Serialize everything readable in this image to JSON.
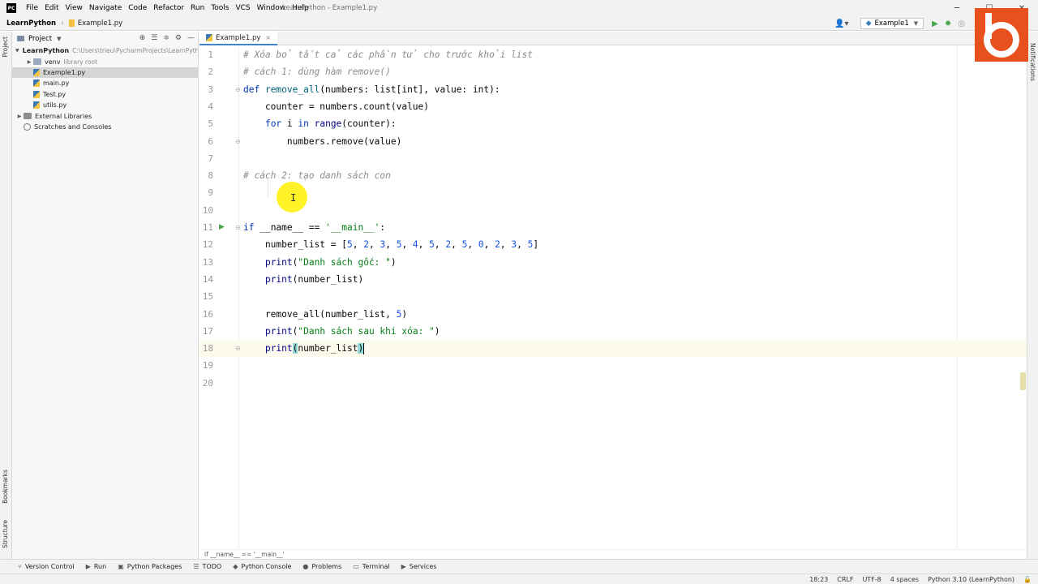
{
  "app": {
    "logo_text": "PC",
    "window_title": "LearnPython - Example1.py",
    "menu": [
      "File",
      "Edit",
      "View",
      "Navigate",
      "Code",
      "Refactor",
      "Run",
      "Tools",
      "VCS",
      "Window",
      "Help"
    ],
    "window_controls": [
      "─",
      "☐",
      "✕"
    ]
  },
  "navbar": {
    "project": "LearnPython",
    "file": "Example1.py",
    "run_config": "Example1",
    "colors": {
      "run": "#4ba34b",
      "accent": "#4083c9"
    }
  },
  "left_strip": {
    "tabs": [
      "Project",
      "Bookmarks",
      "Structure"
    ]
  },
  "right_strip": {
    "tabs": [
      "Notifications"
    ]
  },
  "project_panel": {
    "title": "Project",
    "tree": [
      {
        "label": "LearnPython",
        "hint": "C:\\Users\\trieu\\PycharmProjects\\LearnPytho",
        "level": 0,
        "arrow": "▼",
        "icon": "folder-icon",
        "bold": true
      },
      {
        "label": "venv",
        "hint": "library root",
        "level": 1,
        "arrow": "▶",
        "icon": "folder-icon"
      },
      {
        "label": "Example1.py",
        "hint": "",
        "level": 1,
        "arrow": "",
        "icon": "python-file-icon",
        "selected": true
      },
      {
        "label": "main.py",
        "hint": "",
        "level": 1,
        "arrow": "",
        "icon": "python-file-icon"
      },
      {
        "label": "Test.py",
        "hint": "",
        "level": 1,
        "arrow": "",
        "icon": "python-file-icon"
      },
      {
        "label": "utils.py",
        "hint": "",
        "level": 1,
        "arrow": "",
        "icon": "python-file-icon"
      },
      {
        "label": "External Libraries",
        "hint": "",
        "level": 0,
        "arrow": "▶",
        "icon": "library-icon"
      },
      {
        "label": "Scratches and Consoles",
        "hint": "",
        "level": 0,
        "arrow": "",
        "icon": "scratch-icon"
      }
    ]
  },
  "editor": {
    "tab_label": "Example1.py",
    "current_line": 18,
    "lines": [
      {
        "n": "1",
        "tokens": [
          [
            "c",
            "# Xóa bỏ tất cả các phần tử cho trước khỏi list"
          ]
        ]
      },
      {
        "n": "2",
        "tokens": [
          [
            "c",
            "# cách 1: dùng hàm remove()"
          ]
        ]
      },
      {
        "n": "3",
        "tokens": [
          [
            "k",
            "def "
          ],
          [
            "f",
            "remove_all"
          ],
          [
            "p",
            "(numbers: list[int], value: int):"
          ]
        ]
      },
      {
        "n": "4",
        "tokens": [
          [
            "p",
            "    counter = numbers.count(value)"
          ]
        ]
      },
      {
        "n": "5",
        "tokens": [
          [
            "p",
            "    "
          ],
          [
            "k",
            "for "
          ],
          [
            "p",
            "i "
          ],
          [
            "k",
            "in "
          ],
          [
            "b",
            "range"
          ],
          [
            "p",
            "(counter):"
          ]
        ]
      },
      {
        "n": "6",
        "tokens": [
          [
            "p",
            "        numbers.remove(value)"
          ]
        ]
      },
      {
        "n": "7",
        "tokens": []
      },
      {
        "n": "8",
        "tokens": [
          [
            "c",
            "# cách 2: tạo danh sách con"
          ]
        ]
      },
      {
        "n": "9",
        "tokens": []
      },
      {
        "n": "10",
        "tokens": []
      },
      {
        "n": "11",
        "tokens": [
          [
            "k",
            "if "
          ],
          [
            "p",
            "__name__ == "
          ],
          [
            "s",
            "'__main__'"
          ],
          [
            "p",
            ":"
          ]
        ]
      },
      {
        "n": "12",
        "tokens": [
          [
            "p",
            "    number_list = ["
          ],
          [
            "n",
            "5"
          ],
          [
            "p",
            ", "
          ],
          [
            "n",
            "2"
          ],
          [
            "p",
            ", "
          ],
          [
            "n",
            "3"
          ],
          [
            "p",
            ", "
          ],
          [
            "n",
            "5"
          ],
          [
            "p",
            ", "
          ],
          [
            "n",
            "4"
          ],
          [
            "p",
            ", "
          ],
          [
            "n",
            "5"
          ],
          [
            "p",
            ", "
          ],
          [
            "n",
            "2"
          ],
          [
            "p",
            ", "
          ],
          [
            "n",
            "5"
          ],
          [
            "p",
            ", "
          ],
          [
            "n",
            "0"
          ],
          [
            "p",
            ", "
          ],
          [
            "n",
            "2"
          ],
          [
            "p",
            ", "
          ],
          [
            "n",
            "3"
          ],
          [
            "p",
            ", "
          ],
          [
            "n",
            "5"
          ],
          [
            "p",
            "]"
          ]
        ]
      },
      {
        "n": "13",
        "tokens": [
          [
            "p",
            "    "
          ],
          [
            "b",
            "print"
          ],
          [
            "p",
            "("
          ],
          [
            "s",
            "\"Danh sách gốc: \""
          ],
          [
            "p",
            ")"
          ]
        ]
      },
      {
        "n": "14",
        "tokens": [
          [
            "p",
            "    "
          ],
          [
            "b",
            "print"
          ],
          [
            "p",
            "(number_list)"
          ]
        ]
      },
      {
        "n": "15",
        "tokens": []
      },
      {
        "n": "16",
        "tokens": [
          [
            "p",
            "    remove_all(number_list, "
          ],
          [
            "n",
            "5"
          ],
          [
            "p",
            ")"
          ]
        ]
      },
      {
        "n": "17",
        "tokens": [
          [
            "p",
            "    "
          ],
          [
            "b",
            "print"
          ],
          [
            "p",
            "("
          ],
          [
            "s",
            "\"Danh sách sau khi xóa: \""
          ],
          [
            "p",
            ")"
          ]
        ]
      },
      {
        "n": "18",
        "tokens": [
          [
            "p",
            "    "
          ],
          [
            "b",
            "print"
          ],
          [
            "h",
            "("
          ],
          [
            "p",
            "number_list"
          ],
          [
            "h",
            ")"
          ],
          [
            "cur",
            ""
          ]
        ]
      },
      {
        "n": "19",
        "tokens": []
      },
      {
        "n": "20",
        "tokens": []
      }
    ],
    "breadcrumb": "if __name__ == '__main__'"
  },
  "tool_windows": [
    {
      "label": "Version Control",
      "icon": "vcs-icon"
    },
    {
      "label": "Run",
      "icon": "run-icon"
    },
    {
      "label": "Python Packages",
      "icon": "packages-icon"
    },
    {
      "label": "TODO",
      "icon": "todo-icon"
    },
    {
      "label": "Python Console",
      "icon": "console-icon"
    },
    {
      "label": "Problems",
      "icon": "problems-icon"
    },
    {
      "label": "Terminal",
      "icon": "terminal-icon"
    },
    {
      "label": "Services",
      "icon": "services-icon"
    }
  ],
  "status": {
    "position": "18:23",
    "line_sep": "CRLF",
    "encoding": "UTF-8",
    "indent": "4 spaces",
    "interpreter": "Python 3.10 (LearnPython)"
  },
  "brand": {
    "color": "#e8511e"
  }
}
